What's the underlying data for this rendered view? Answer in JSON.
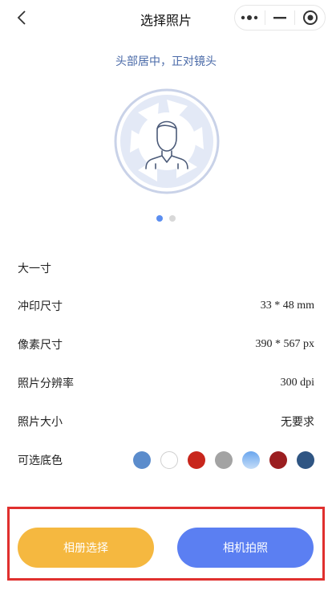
{
  "navbar": {
    "title": "选择照片"
  },
  "hint": "头部居中，正对镜头",
  "carousel": {
    "active_index": 0,
    "total": 2
  },
  "specs": {
    "size_name": "大一寸",
    "print_size": {
      "label": "冲印尺寸",
      "value": "33 * 48 mm"
    },
    "pixel_size": {
      "label": "像素尺寸",
      "value": "390 * 567 px"
    },
    "resolution": {
      "label": "照片分辨率",
      "value": "300 dpi"
    },
    "file_size": {
      "label": "照片大小",
      "value": "无要求"
    },
    "bg_colors": {
      "label": "可选底色",
      "colors": [
        "#5b8ccc",
        "#ffffff",
        "#c8261c",
        "#a3a3a3",
        "#8fbdf2",
        "#9b1e20",
        "#2f5583"
      ]
    }
  },
  "buttons": {
    "album": "相册选择",
    "camera": "相机拍照"
  },
  "colors": {
    "accent_blue": "#5b7ff2",
    "accent_orange": "#f5b840",
    "highlight_red": "#e0302e"
  }
}
